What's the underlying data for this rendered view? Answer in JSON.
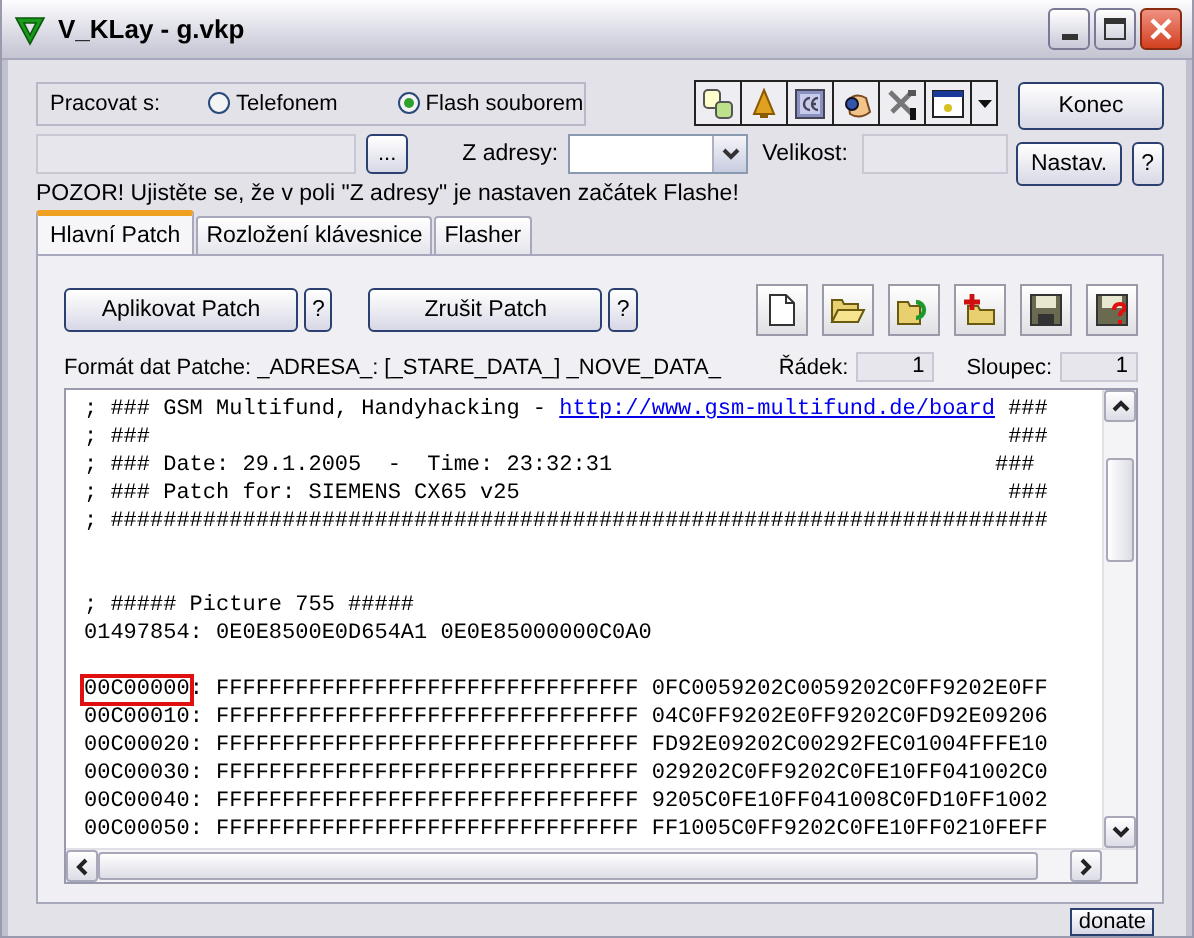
{
  "window": {
    "title": "V_KLay - g.vkp"
  },
  "work_with": {
    "label": "Pracovat s:",
    "options": [
      {
        "label": "Telefonem",
        "selected": false
      },
      {
        "label": "Flash souborem",
        "selected": true
      }
    ]
  },
  "side_buttons": {
    "exit": "Konec",
    "settings": "Nastav.",
    "help": "?"
  },
  "file_row": {
    "browse": "...",
    "from_label": "Z adresy:",
    "size_label": "Velikost:"
  },
  "warning": "POZOR! Ujistěte se, že v poli \"Z adresy\" je nastaven začátek Flashe!",
  "tabs": [
    {
      "label": "Hlavní Patch",
      "selected": true
    },
    {
      "label": "Rozložení klávesnice",
      "selected": false
    },
    {
      "label": "Flasher",
      "selected": false
    }
  ],
  "patch_actions": [
    {
      "label": "Aplikovat Patch",
      "help": "?"
    },
    {
      "label": "Zrušit Patch",
      "help": "?"
    }
  ],
  "format_label": "Formát dat Patche: _ADRESA_: [_STARE_DATA_] _NOVE_DATA_",
  "position": {
    "row_label": "Řádek:",
    "row": "1",
    "column_label": "Sloupec:",
    "column": "1"
  },
  "editor": {
    "lines": [
      {
        "kind": "link",
        "before": "; ### GSM Multifund, Handyhacking - ",
        "link": "http://www.gsm-multifund.de/board",
        "after": " ###"
      },
      {
        "kind": "text",
        "text": "; ###                                                                 ###"
      },
      {
        "kind": "text",
        "text": "; ### Date: 29.1.2005  -  Time: 23:32:31                             ###"
      },
      {
        "kind": "text",
        "text": "; ### Patch for: SIEMENS CX65 v25                                     ###"
      },
      {
        "kind": "text",
        "text": "; #######################################################################"
      },
      {
        "kind": "blank"
      },
      {
        "kind": "blank"
      },
      {
        "kind": "text",
        "text": "; ##### Picture 755 #####"
      },
      {
        "kind": "text",
        "text": "01497854: 0E0E8500E0D654A1 0E0E85000000C0A0"
      },
      {
        "kind": "blank"
      },
      {
        "kind": "hex",
        "address": "00C00000",
        "highlighted": true,
        "data": ": FFFFFFFFFFFFFFFFFFFFFFFFFFFFFFFF 0FC0059202C0059202C0FF9202E0FF"
      },
      {
        "kind": "hex",
        "address": "00C00010",
        "highlighted": false,
        "data": ": FFFFFFFFFFFFFFFFFFFFFFFFFFFFFFFF 04C0FF9202E0FF9202C0FD92E09206"
      },
      {
        "kind": "hex",
        "address": "00C00020",
        "highlighted": false,
        "data": ": FFFFFFFFFFFFFFFFFFFFFFFFFFFFFFFF FD92E09202C00292FEC01004FFFE10"
      },
      {
        "kind": "hex",
        "address": "00C00030",
        "highlighted": false,
        "data": ": FFFFFFFFFFFFFFFFFFFFFFFFFFFFFFFF 029202C0FF9202C0FE10FF041002C0"
      },
      {
        "kind": "hex",
        "address": "00C00040",
        "highlighted": false,
        "data": ": FFFFFFFFFFFFFFFFFFFFFFFFFFFFFFFF 9205C0FE10FF041008C0FD10FF1002"
      },
      {
        "kind": "hex",
        "address": "00C00050",
        "highlighted": false,
        "data": ": FFFFFFFFFFFFFFFFFFFFFFFFFFFFFFFF FF1005C0FF9202C0FE10FF0210FEFF"
      }
    ]
  },
  "donate": "donate"
}
